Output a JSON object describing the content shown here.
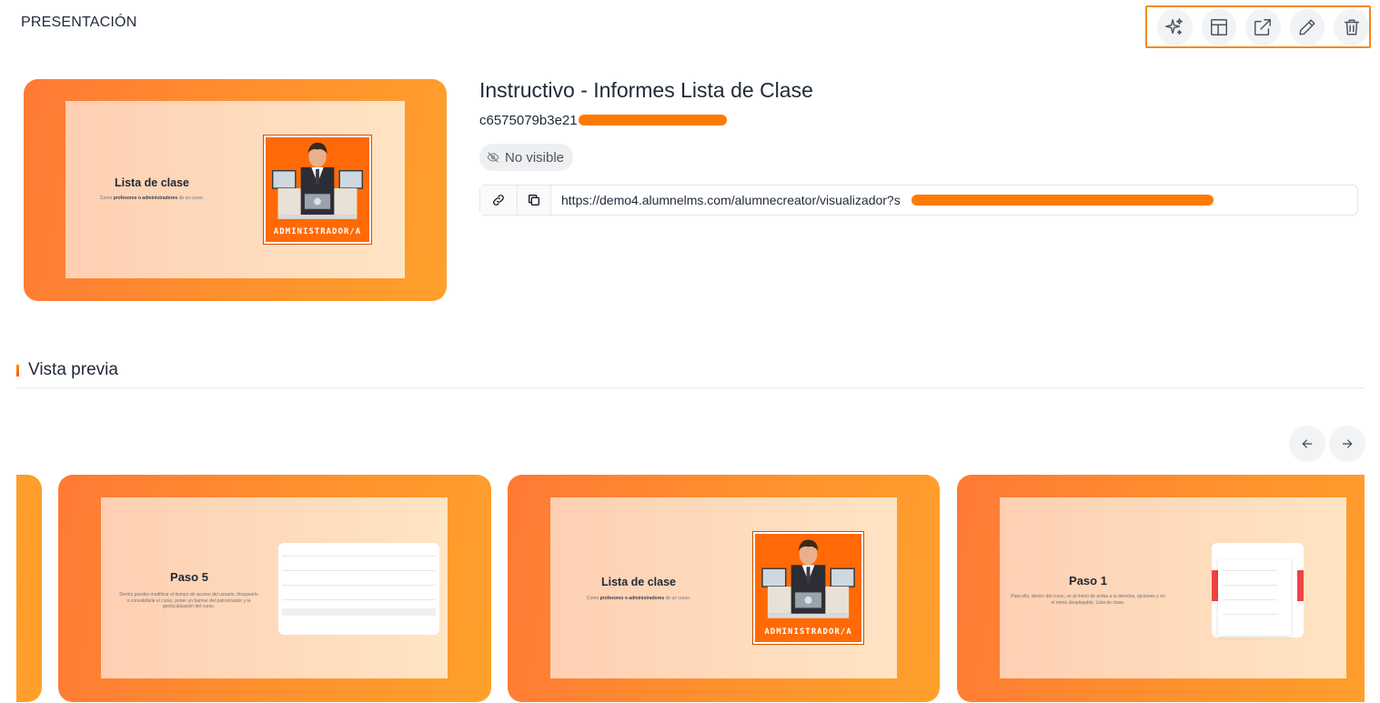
{
  "header": {
    "section_label": "PRESENTACIÓN"
  },
  "toolbar": {
    "buttons": [
      {
        "icon": "sparkles-icon",
        "name": "ai-button"
      },
      {
        "icon": "layout-icon",
        "name": "layout-button"
      },
      {
        "icon": "external-link-icon",
        "name": "open-external-button"
      },
      {
        "icon": "pencil-icon",
        "name": "edit-button"
      },
      {
        "icon": "trash-icon",
        "name": "delete-button"
      }
    ],
    "highlight_color": "#f08a1c"
  },
  "presentation": {
    "title": "Instructivo - Informes Lista de Clase",
    "id_prefix": "c6575079b3e21",
    "visibility": "No visible",
    "url": "https://demo4.alumnelms.com/alumnecreator/visualizador?s",
    "redaction_color": "#ff7a00"
  },
  "cover": {
    "title": "Lista de clase",
    "subtitle_parts": [
      "Como ",
      "profesores o administradores",
      " de un curso."
    ],
    "avatar_caption": "ADMINISTRADOR/A"
  },
  "preview": {
    "label": "Vista previa",
    "slides": [
      {
        "title": "Paso 5",
        "text": "Dentro puedes modificar el tiempo de acceso del usuario, bloquearlo o convalidarle el curso, poner un banner del patrocinador y la geolocalización del curso."
      },
      {
        "title": "Lista de clase",
        "subtitle_parts": [
          "Como ",
          "profesores o administradores",
          " de un curso."
        ],
        "avatar_caption": "ADMINISTRADOR/A"
      },
      {
        "title": "Paso 1",
        "text": "Para ello, dentro del curso, ve al menú de arriba a la derecha, opciones y en el menú desplegable, Lista de clase."
      }
    ]
  }
}
